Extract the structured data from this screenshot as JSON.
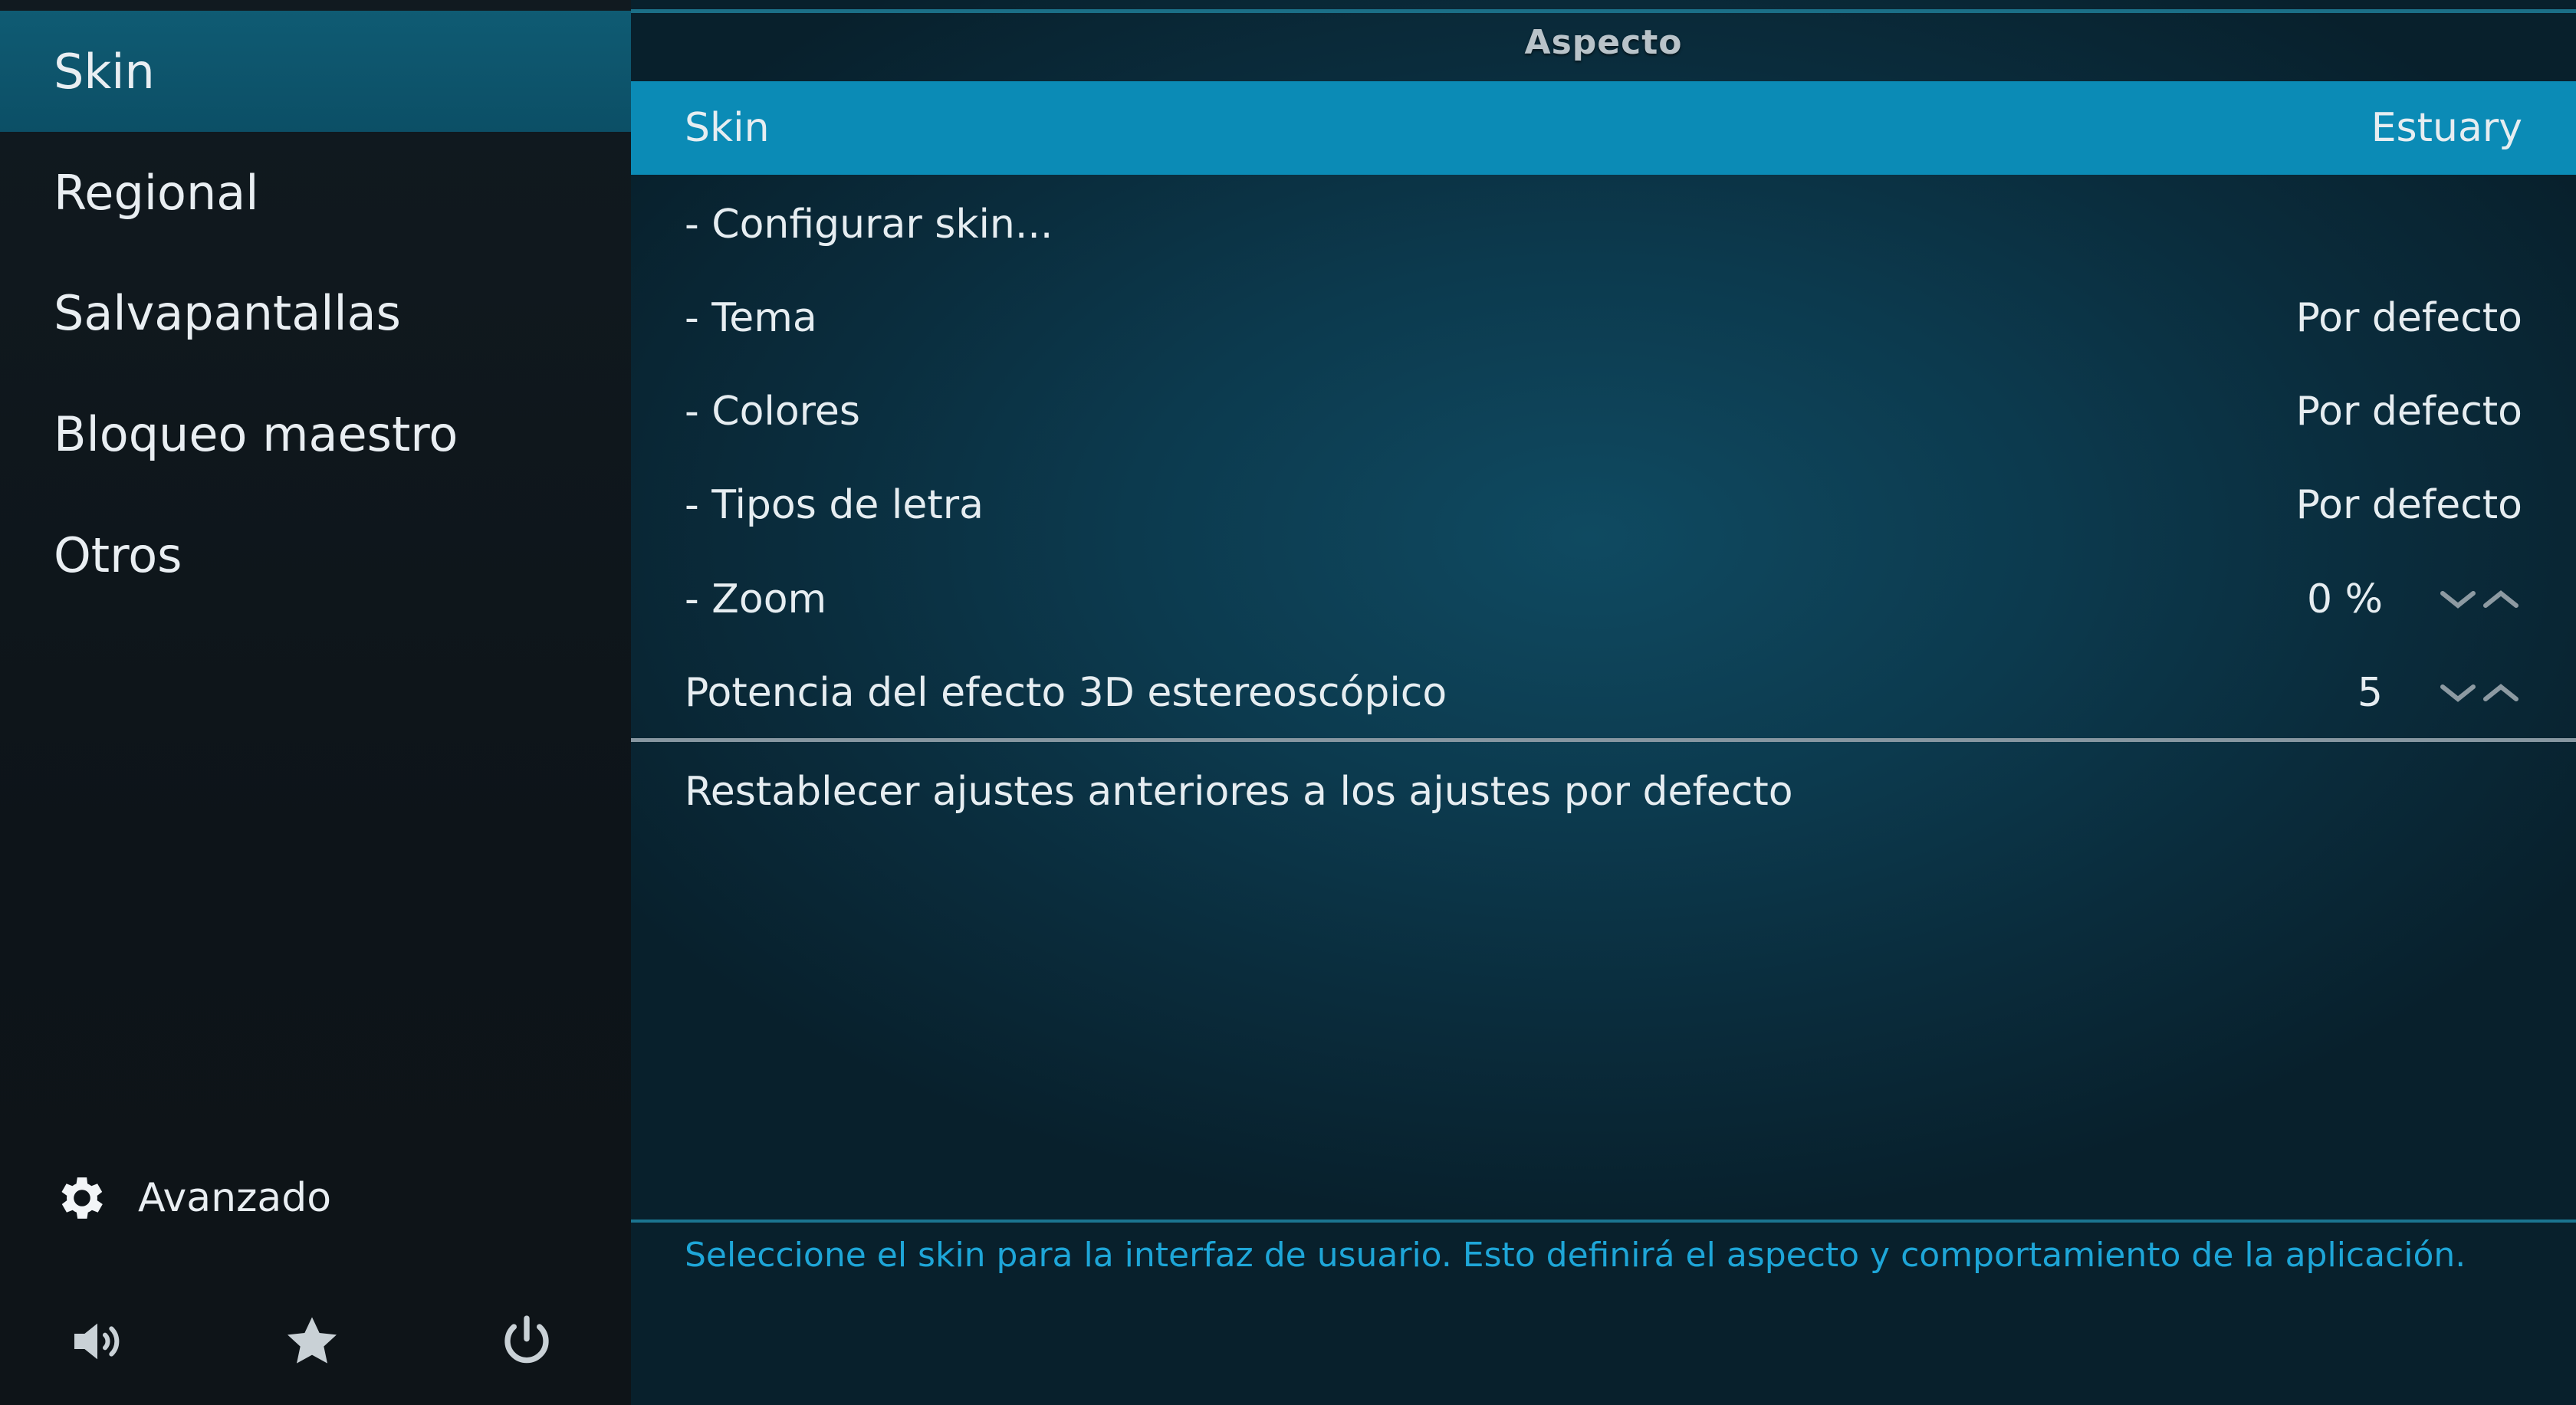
{
  "sidebar": {
    "items": [
      {
        "label": "Skin",
        "active": true
      },
      {
        "label": "Regional"
      },
      {
        "label": "Salvapantallas"
      },
      {
        "label": "Bloqueo maestro"
      },
      {
        "label": "Otros"
      }
    ],
    "advanced_label": "Avanzado",
    "bottom_icons": [
      "volume-icon",
      "star-icon",
      "power-icon"
    ]
  },
  "panel": {
    "title": "Aspecto",
    "rows": [
      {
        "label": "Skin",
        "value": "Estuary",
        "selected": true
      },
      {
        "label": "- Configurar skin...",
        "value": ""
      },
      {
        "label": "- Tema",
        "value": "Por defecto"
      },
      {
        "label": "- Colores",
        "value": "Por defecto"
      },
      {
        "label": "- Tipos de letra",
        "value": "Por defecto"
      },
      {
        "label": "- Zoom",
        "value": "0 %",
        "spinner": true
      },
      {
        "label": "Potencia del efecto 3D estereoscópico",
        "value": "5",
        "spinner": true
      }
    ],
    "reset_label": "Restablecer ajustes anteriores a los ajustes por defecto",
    "help_text": "Seleccione el skin para la interfaz de usuario. Esto definirá el aspecto y comportamiento de la aplicación."
  },
  "colors": {
    "selected_row": "#0b8bb6",
    "active_sidebar": "#0f5b73",
    "help_text": "#1ea6d8"
  }
}
